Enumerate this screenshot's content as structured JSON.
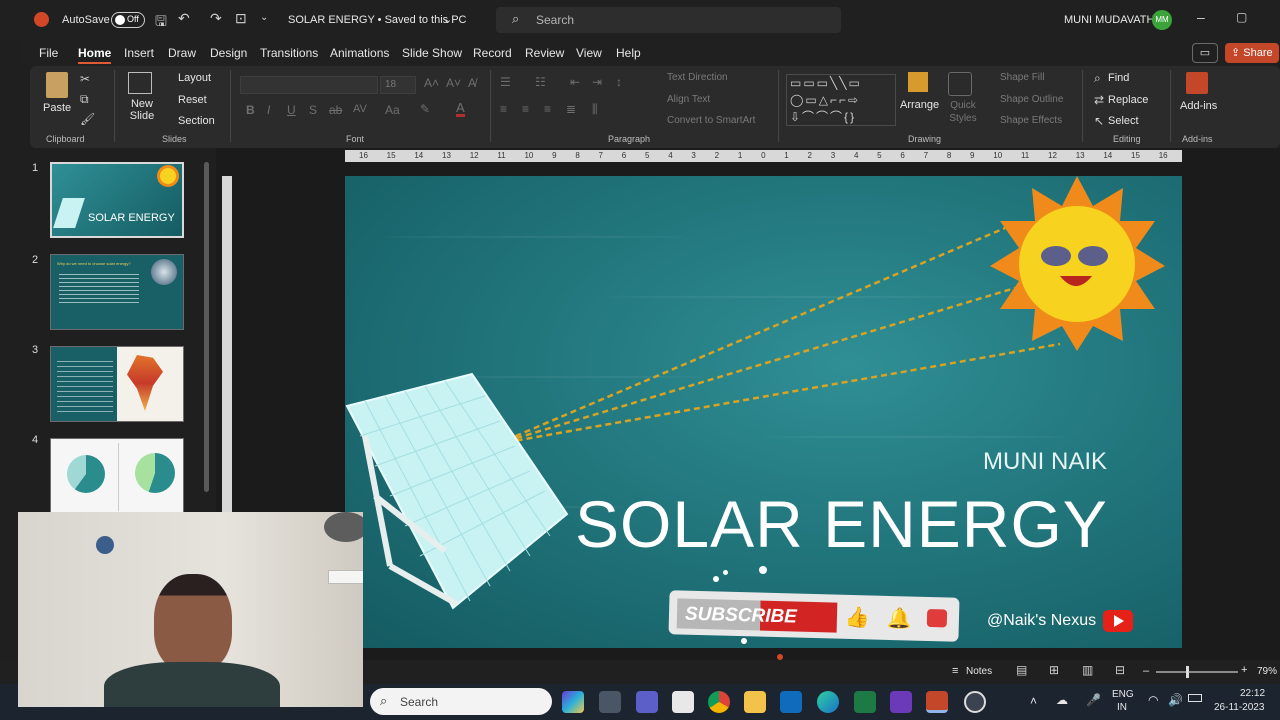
{
  "titlebar": {
    "autosave_label": "AutoSave",
    "autosave_state": "Off",
    "doc_title": "SOLAR ENERGY • Saved to this PC",
    "search_placeholder": "Search",
    "user_name": "MUNI MUDAVATH",
    "user_initials": "MM"
  },
  "menu": {
    "items": [
      "File",
      "Home",
      "Insert",
      "Draw",
      "Design",
      "Transitions",
      "Animations",
      "Slide Show",
      "Record",
      "Review",
      "View",
      "Help"
    ],
    "share_label": "Share"
  },
  "ribbon": {
    "clipboard": {
      "paste": "Paste",
      "group": "Clipboard"
    },
    "slides": {
      "new_slide": "New Slide",
      "layout": "Layout",
      "reset": "Reset",
      "section": "Section",
      "group": "Slides"
    },
    "font": {
      "size": "18",
      "group": "Font"
    },
    "paragraph": {
      "text_direction": "Text Direction",
      "align_text": "Align Text",
      "smartart": "Convert to SmartArt",
      "group": "Paragraph"
    },
    "drawing": {
      "arrange": "Arrange",
      "quick_styles": "Quick Styles",
      "shape_fill": "Shape Fill",
      "shape_outline": "Shape Outline",
      "shape_effects": "Shape Effects",
      "group": "Drawing"
    },
    "editing": {
      "find": "Find",
      "replace": "Replace",
      "select": "Select",
      "group": "Editing"
    },
    "addins": {
      "label": "Add-ins",
      "group": "Add-ins"
    }
  },
  "ruler": {
    "ticks": [
      "16",
      "15",
      "14",
      "13",
      "12",
      "11",
      "10",
      "9",
      "8",
      "7",
      "6",
      "5",
      "4",
      "3",
      "2",
      "1",
      "0",
      "1",
      "2",
      "3",
      "4",
      "5",
      "6",
      "7",
      "8",
      "9",
      "10",
      "11",
      "12",
      "13",
      "14",
      "15",
      "16"
    ]
  },
  "slides_panel": {
    "thumbs": [
      {
        "num": "1",
        "title": "SOLAR ENERGY"
      },
      {
        "num": "2",
        "title": "Why do we need to choose solar energy?"
      },
      {
        "num": "3",
        "title": ""
      },
      {
        "num": "4",
        "title": ""
      }
    ]
  },
  "slide": {
    "author": "MUNI NAIK",
    "title": "SOLAR ENERGY",
    "subscribe": "SUBSCRIBE",
    "channel": "@Naik's Nexus"
  },
  "statusbar": {
    "notes": "Notes",
    "zoom": "79%"
  },
  "taskbar": {
    "search": "Search",
    "lang_top": "ENG",
    "lang_bottom": "IN",
    "time": "22:12",
    "date": "26-11-2023"
  },
  "colors": {
    "accent": "#e05a33",
    "slide_bg": "#21767c",
    "sun": "#f7d21e",
    "sun_rays": "#f08a1a"
  }
}
